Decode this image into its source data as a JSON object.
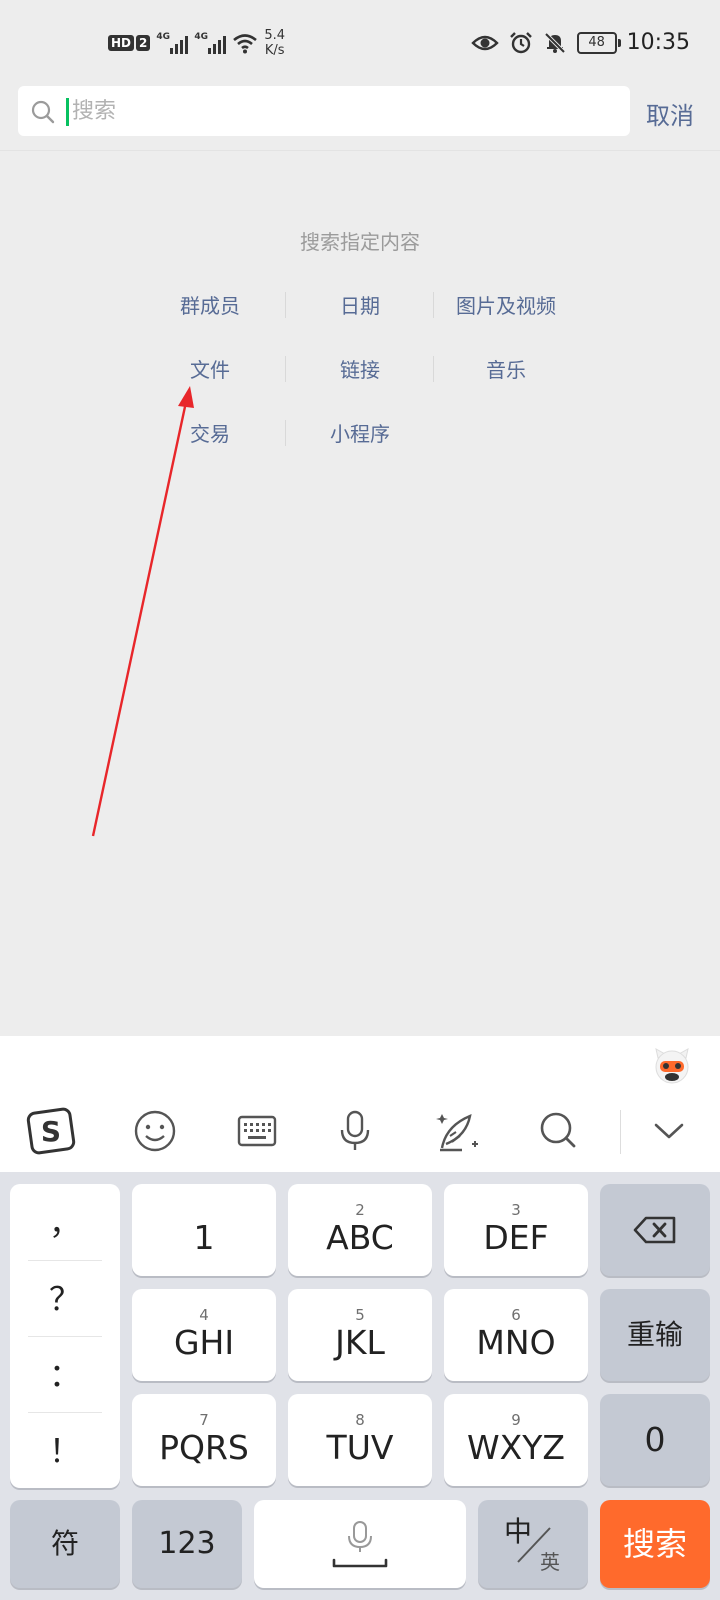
{
  "status_bar": {
    "hd_label": "HD",
    "hd_sim": "2",
    "sim1_tag": "4G",
    "sim2_tag": "4G",
    "net_speed_value": "5.4",
    "net_speed_unit": "K/s",
    "battery": "48",
    "time": "10:35"
  },
  "search": {
    "placeholder": "搜索",
    "value": "",
    "cancel_label": "取消"
  },
  "categories": {
    "title": "搜索指定内容",
    "items": [
      "群成员",
      "日期",
      "图片及视频",
      "文件",
      "链接",
      "音乐",
      "交易",
      "小程序"
    ]
  },
  "annotation": {
    "arrow_color": "#e8262a",
    "target": "文件"
  },
  "keyboard": {
    "toolbar_icons": [
      "sogou-logo-icon",
      "emoji-icon",
      "keyboard-icon",
      "microphone-icon",
      "handwriting-icon",
      "search-icon",
      "collapse-chevron-icon"
    ],
    "punctuation": [
      "，",
      "？",
      "：",
      "！"
    ],
    "keys": [
      {
        "sub": "",
        "main": "1"
      },
      {
        "sub": "2",
        "main": "ABC"
      },
      {
        "sub": "3",
        "main": "DEF"
      },
      {
        "sub": "4",
        "main": "GHI"
      },
      {
        "sub": "5",
        "main": "JKL"
      },
      {
        "sub": "6",
        "main": "MNO"
      },
      {
        "sub": "7",
        "main": "PQRS"
      },
      {
        "sub": "8",
        "main": "TUV"
      },
      {
        "sub": "9",
        "main": "WXYZ"
      }
    ],
    "reenter_label": "重输",
    "zero_label": "0",
    "symbol_label": "符",
    "numeric_label": "123",
    "zh_label": "中",
    "en_label": "英",
    "search_label": "搜索"
  },
  "colors": {
    "accent_link": "#576b95",
    "caret": "#07c160",
    "search_key": "#ff6a2c"
  }
}
